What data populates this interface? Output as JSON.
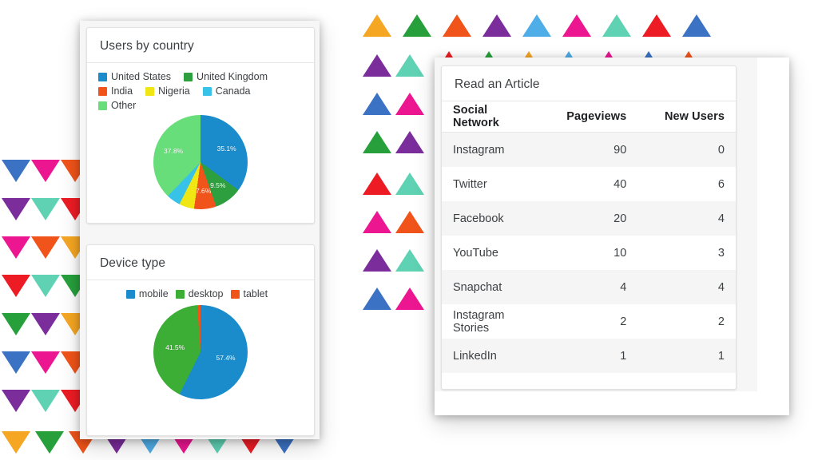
{
  "decor": {
    "palette": {
      "orange": "#F5A623",
      "green": "#27A03C",
      "orangered": "#F1541A",
      "purple": "#7B2D9B",
      "lightblue": "#4FADE8",
      "magenta": "#ED1691",
      "teal": "#5FD2B4",
      "red": "#ED1C24",
      "blue": "#3B72C4"
    },
    "left_down_triangles": [
      [
        "blue",
        "magenta",
        "orangered"
      ],
      [
        "purple",
        "teal",
        "red"
      ],
      [
        "magenta",
        "orangered",
        "orange"
      ],
      [
        "red",
        "teal",
        "green"
      ],
      [
        "green",
        "purple",
        "orange"
      ],
      [
        "blue",
        "magenta",
        "orangered"
      ],
      [
        "purple",
        "teal",
        "red"
      ]
    ],
    "bottom_down_triangles": [
      "orange",
      "green",
      "orangered",
      "purple",
      "lightblue",
      "magenta",
      "teal",
      "red",
      "blue"
    ],
    "top_up_triangles": [
      "orange",
      "green",
      "orangered",
      "purple",
      "lightblue",
      "magenta",
      "teal",
      "red",
      "blue"
    ],
    "right_up_triangles": [
      [
        "purple",
        "teal"
      ],
      [
        "blue",
        "magenta"
      ],
      [
        "green",
        "purple"
      ],
      [
        "red",
        "teal"
      ],
      [
        "magenta",
        "orangered"
      ],
      [
        "purple",
        "teal"
      ],
      [
        "blue",
        "magenta"
      ]
    ],
    "tiny_up_triangles": [
      "red",
      "green",
      "orange",
      "lightblue",
      "magenta",
      "blue",
      "orangered"
    ]
  },
  "left_panel": {
    "country_card": {
      "title": "Users by country",
      "legend": [
        {
          "label": "United States",
          "color": "#1A8BCB"
        },
        {
          "label": "United Kingdom",
          "color": "#2E9F3E"
        },
        {
          "label": "India",
          "color": "#F1541A"
        },
        {
          "label": "Nigeria",
          "color": "#F0E613"
        },
        {
          "label": "Canada",
          "color": "#39C2E8"
        },
        {
          "label": "Other",
          "color": "#67DE7A"
        }
      ],
      "chart_data": {
        "type": "pie",
        "title": "Users by country",
        "categories": [
          "United States",
          "United Kingdom",
          "India",
          "Nigeria",
          "Canada",
          "Other"
        ],
        "values": [
          35.1,
          9.5,
          7.6,
          5.2,
          4.8,
          37.8
        ],
        "value_unit": "%",
        "colors": [
          "#1A8BCB",
          "#2E9F3E",
          "#F1541A",
          "#F0E613",
          "#39C2E8",
          "#67DE7A"
        ],
        "labels_shown": [
          "35.1%",
          "9.5%",
          "7.6%",
          "",
          "",
          "37.8%"
        ],
        "legend_position": "top"
      }
    },
    "device_card": {
      "title": "Device type",
      "legend": [
        {
          "label": "mobile",
          "color": "#1A8BCB"
        },
        {
          "label": "desktop",
          "color": "#3DAE35"
        },
        {
          "label": "tablet",
          "color": "#F1541A"
        }
      ],
      "chart_data": {
        "type": "pie",
        "title": "Device type",
        "categories": [
          "mobile",
          "desktop",
          "tablet"
        ],
        "values": [
          57.4,
          41.5,
          1.1
        ],
        "value_unit": "%",
        "colors": [
          "#1A8BCB",
          "#3DAE35",
          "#F1541A"
        ],
        "labels_shown": [
          "57.4%",
          "41.5%",
          ""
        ],
        "legend_position": "top"
      }
    }
  },
  "right_panel": {
    "table_card": {
      "title": "Read an Article",
      "columns": [
        "Social Network",
        "Pageviews",
        "New Users"
      ],
      "rows": [
        {
          "network": "Instagram",
          "pageviews": "90",
          "new_users": "0"
        },
        {
          "network": "Twitter",
          "pageviews": "40",
          "new_users": "6"
        },
        {
          "network": "Facebook",
          "pageviews": "20",
          "new_users": "4"
        },
        {
          "network": "YouTube",
          "pageviews": "10",
          "new_users": "3"
        },
        {
          "network": "Snapchat",
          "pageviews": "4",
          "new_users": "4"
        },
        {
          "network": "Instagram Stories",
          "pageviews": "2",
          "new_users": "2"
        },
        {
          "network": "LinkedIn",
          "pageviews": "1",
          "new_users": "1"
        }
      ]
    }
  }
}
